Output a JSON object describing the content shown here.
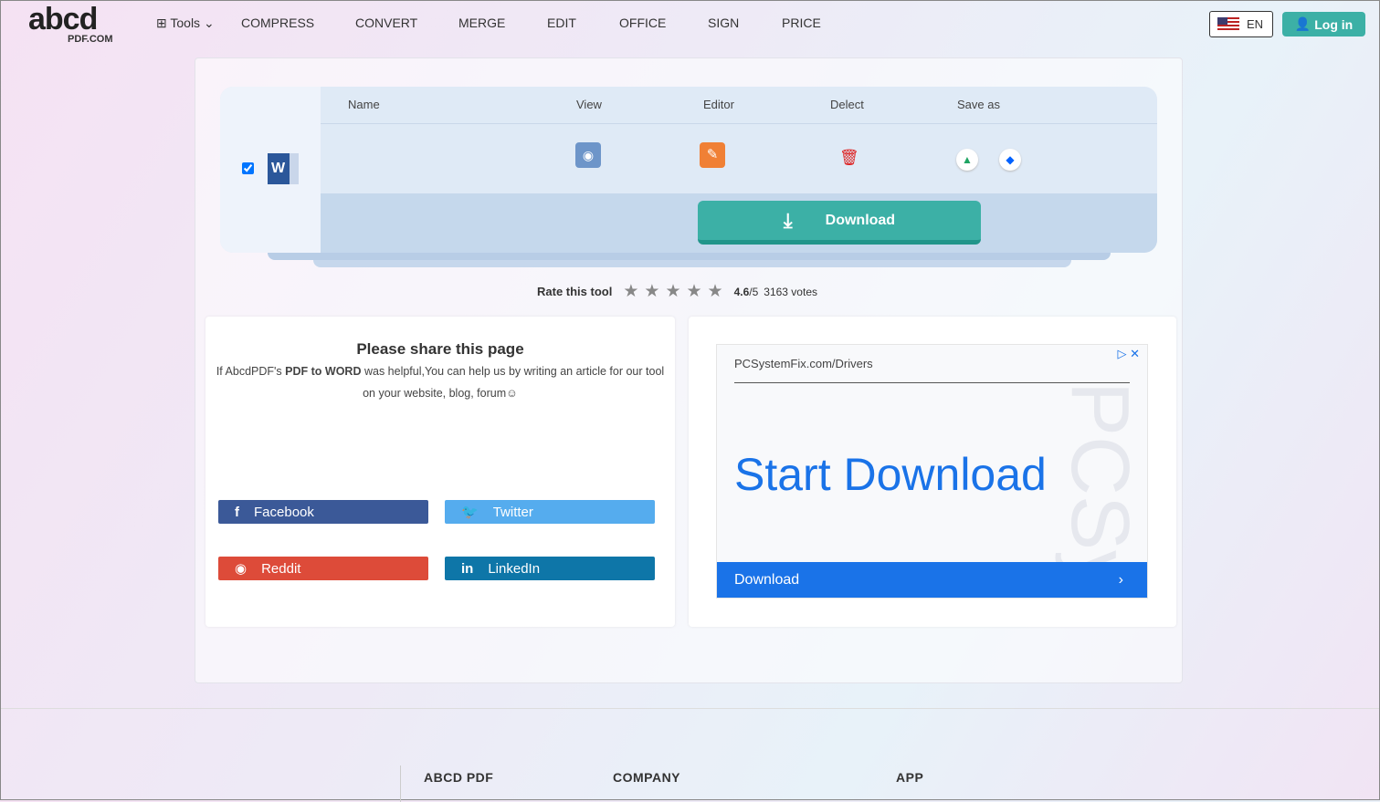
{
  "nav": {
    "logo_main": "abcd",
    "logo_sub": "PDF.COM",
    "tools": "Tools",
    "items": [
      "COMPRESS",
      "CONVERT",
      "MERGE",
      "EDIT",
      "OFFICE",
      "SIGN",
      "PRICE"
    ],
    "lang": "EN",
    "login": "Log in"
  },
  "file": {
    "headers": {
      "name": "Name",
      "view": "View",
      "editor": "Editor",
      "delete": "Delect",
      "save_as": "Save as"
    },
    "checked": true,
    "download": "Download"
  },
  "rating": {
    "label": "Rate this tool",
    "score": "4.6",
    "out_of": "/5",
    "votes": "3163 votes",
    "stars": 5
  },
  "share": {
    "title": "Please share this page",
    "text_pre": "If AbcdPDF's ",
    "bold1": "PDF to WORD",
    "text_mid": " was helpful,You can help us by writing an article for our tool on your website, blog, forum☺",
    "buttons": {
      "facebook": "Facebook",
      "twitter": "Twitter",
      "reddit": "Reddit",
      "linkedin": "LinkedIn"
    }
  },
  "ad": {
    "domain": "PCSystemFix.com/Drivers",
    "headline": "Start Download",
    "cta": "Download",
    "watermark": "PCSys"
  },
  "footer": {
    "cols": [
      "ABCD PDF",
      "COMPANY",
      "APP"
    ]
  },
  "colors": {
    "accent": "#3cb0a6",
    "facebook": "#3b5998",
    "twitter": "#55acee",
    "reddit": "#dd4b39",
    "linkedin": "#0e76a8",
    "ad_blue": "#1a73e8"
  }
}
